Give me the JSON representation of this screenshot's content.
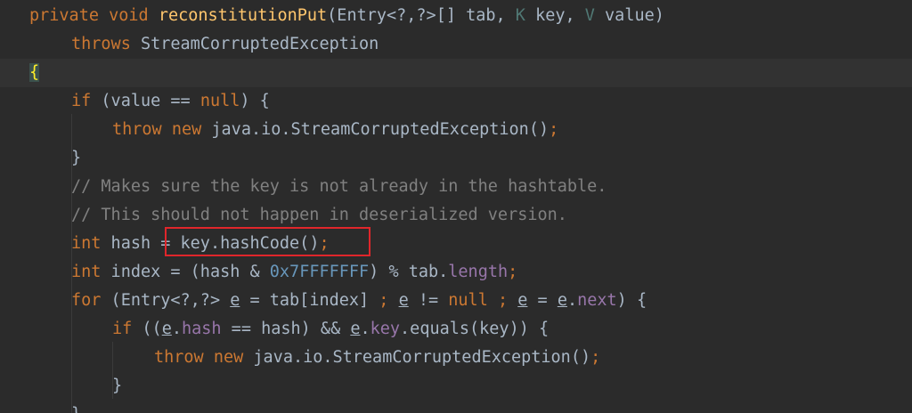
{
  "code": {
    "lines": [
      {
        "kw1": "private",
        "kw2": "void",
        "fn": "reconstitutionPut",
        "p1": "(Entry<?,?>[] tab, ",
        "tk": "K",
        "p2": " key, ",
        "tv": "V",
        "p3": " value)"
      },
      {
        "kw": "throws",
        "rest": " StreamCorruptedException"
      },
      {
        "brace": "{"
      },
      {
        "kw": "if",
        "a": " (value == ",
        "kw2": "null",
        "b": ") {"
      },
      {
        "kw1": "throw",
        "kw2": "new",
        "rest": " java.io.StreamCorruptedException()",
        "semi": ";"
      },
      {
        "text": "}"
      },
      {
        "comment": "// Makes sure the key is not already in the hashtable."
      },
      {
        "comment": "// This should not happen in deserialized version."
      },
      {
        "kw": "int",
        "rest": " hash = key.hashCode()",
        "semi": ";"
      },
      {
        "kw": "int",
        "a": " index = (hash & ",
        "num": "0x7FFFFFFF",
        "b": ") % tab.",
        "field": "length",
        "semi": ";"
      },
      {
        "kw": "for",
        "a": " (Entry<?,?> ",
        "e1": "e",
        "b": " = tab[index] ",
        "s1": ";",
        "c": " ",
        "e2": "e",
        "d": " != ",
        "kw2": "null",
        "e": " ",
        "s2": ";",
        "f": " ",
        "e3": "e",
        "g": " = ",
        "e4": "e",
        "h": ".",
        "field": "next",
        "i": ") {"
      },
      {
        "kw": "if",
        "a": " ((",
        "e1": "e",
        "b": ".",
        "field1": "hash",
        "c": " == hash) && ",
        "e2": "e",
        "d": ".",
        "field2": "key",
        "e": ".equals(key)) {"
      },
      {
        "kw1": "throw",
        "kw2": "new",
        "rest": " java.io.StreamCorruptedException()",
        "semi": ";"
      },
      {
        "text": "}"
      },
      {
        "text": "}"
      }
    ]
  }
}
